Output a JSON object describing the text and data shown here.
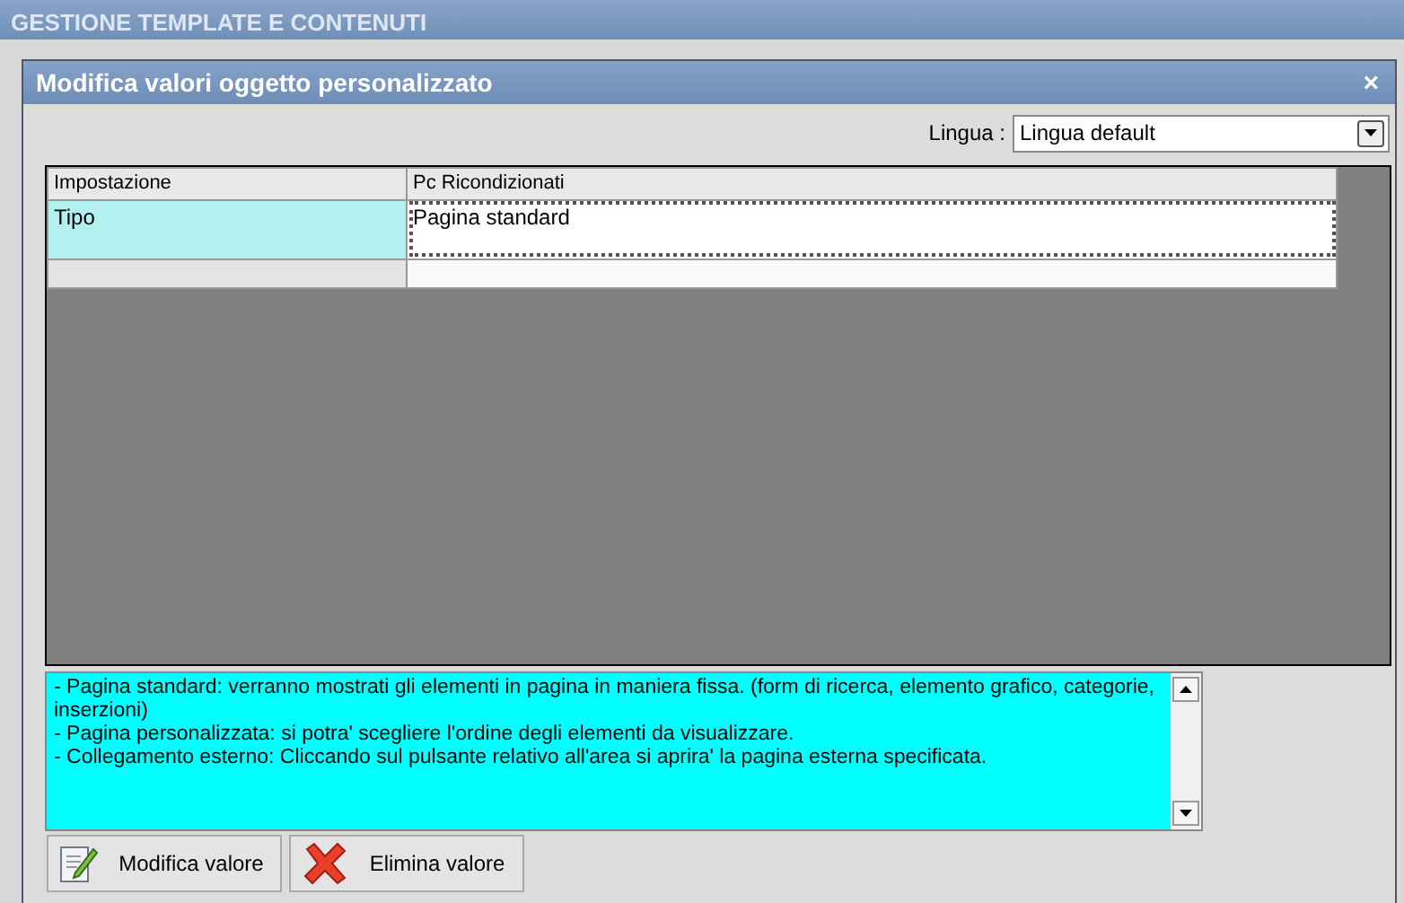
{
  "app": {
    "title": "GESTIONE TEMPLATE E CONTENUTI"
  },
  "dialog": {
    "title": "Modifica valori oggetto personalizzato",
    "close": "×",
    "language": {
      "label": "Lingua :",
      "value": "Lingua default"
    },
    "table": {
      "columns": [
        "Impostazione",
        "Pc Ricondizionati"
      ],
      "rows": [
        {
          "setting": "Tipo",
          "value": "Pagina standard",
          "selected": true
        }
      ]
    },
    "description": [
      "- Pagina standard: verranno mostrati gli elementi in pagina in maniera fissa. (form di ricerca, elemento grafico, categorie, inserzioni)",
      "- Pagina personalizzata: si potra' scegliere l'ordine degli elementi da visualizzare.",
      "- Collegamento esterno: Cliccando sul pulsante relativo all'area si aprira' la pagina esterna specificata."
    ],
    "buttons": [
      {
        "label": "Modifica valore",
        "kind": "edit"
      },
      {
        "label": "Elimina valore",
        "kind": "delete"
      }
    ]
  }
}
